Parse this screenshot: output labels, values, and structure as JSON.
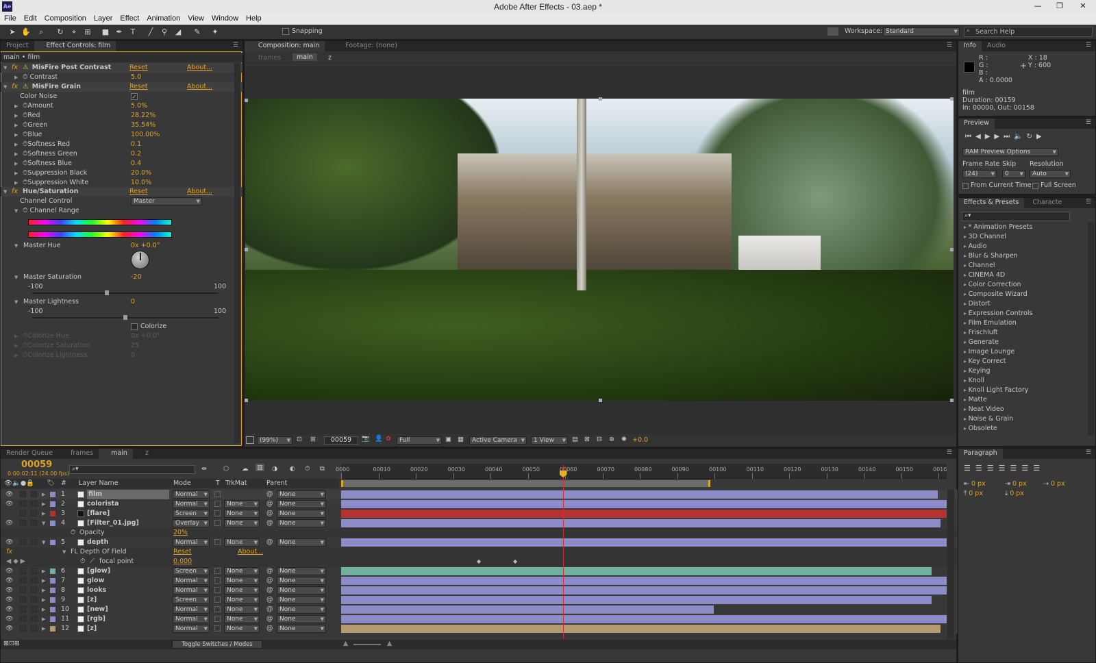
{
  "app": {
    "title": "Adobe After Effects - 03.aep *",
    "logo": "Ae"
  },
  "menu": [
    "File",
    "Edit",
    "Composition",
    "Layer",
    "Effect",
    "Animation",
    "View",
    "Window",
    "Help"
  ],
  "toolbar": {
    "snapping": "Snapping",
    "workspace_label": "Workspace:",
    "workspace_value": "Standard",
    "search_placeholder": "Search Help"
  },
  "left_panel": {
    "tabs": [
      "Project",
      "Effect Controls: film"
    ],
    "breadcrumb": "main • film",
    "effects": [
      {
        "name": "MisFire Post Contrast",
        "reset": "Reset",
        "about": "About..."
      },
      {
        "name": "MisFire Grain",
        "reset": "Reset",
        "about": "About..."
      },
      {
        "name": "Hue/Saturation",
        "reset": "Reset",
        "about": "About..."
      }
    ],
    "contrast": {
      "label": "Contrast",
      "value": "5.0"
    },
    "color_noise": {
      "label": "Color Noise",
      "value": "✓"
    },
    "grain_params": [
      {
        "label": "Amount",
        "value": "5.0%"
      },
      {
        "label": "Red",
        "value": "28.22%"
      },
      {
        "label": "Green",
        "value": "35.54%"
      },
      {
        "label": "Blue",
        "value": "100.00%"
      },
      {
        "label": "Softness Red",
        "value": "0.1"
      },
      {
        "label": "Softness Green",
        "value": "0.2"
      },
      {
        "label": "Softness Blue",
        "value": "0.4"
      },
      {
        "label": "Suppression Black",
        "value": "20.0%"
      },
      {
        "label": "Suppression White",
        "value": "10.0%"
      }
    ],
    "channel_control": {
      "label": "Channel Control",
      "value": "Master"
    },
    "channel_range": "Channel Range",
    "master_hue": {
      "label": "Master Hue",
      "value": "0x +0.0°"
    },
    "master_saturation": {
      "label": "Master Saturation",
      "value": "-20",
      "min": "-100",
      "max": "100",
      "level": 0.4
    },
    "master_lightness": {
      "label": "Master Lightness",
      "value": "0",
      "min": "-100",
      "max": "100",
      "level": 0.5
    },
    "colorize": "Colorize",
    "disabled": [
      {
        "label": "Colorize Hue",
        "value": "0x +0.0°"
      },
      {
        "label": "Colorize Saturation",
        "value": "25"
      },
      {
        "label": "Colorize Lightness",
        "value": "0"
      }
    ]
  },
  "comp_panel": {
    "tabs": [
      "Composition: main",
      "Footage: (none)"
    ],
    "subtabs": [
      "frames",
      "main",
      "z"
    ],
    "footer": {
      "zoom": "(99%)",
      "timecode": "00059",
      "resolution": "Full",
      "camera": "Active Camera",
      "views": "1 View",
      "exposure": "+0.0"
    }
  },
  "info_panel": {
    "tabs": [
      "Info",
      "Audio"
    ],
    "r": "R :",
    "g": "G :",
    "b": "B :",
    "a": "A : 0.0000",
    "x": "X : 18",
    "y": "Y : 600",
    "name": "film",
    "duration": "Duration: 00159",
    "inout": "In: 00000, Out: 00158"
  },
  "preview_panel": {
    "tab": "Preview",
    "ram_options": "RAM Preview Options",
    "frame_rate": {
      "label": "Frame Rate",
      "value": "(24)"
    },
    "skip": {
      "label": "Skip",
      "value": "0"
    },
    "resolution": {
      "label": "Resolution",
      "value": "Auto"
    },
    "from_current": "From Current Time",
    "full_screen": "Full Screen"
  },
  "effects_panel": {
    "tabs": [
      "Effects & Presets",
      "Characte"
    ],
    "items": [
      "* Animation Presets",
      "3D Channel",
      "Audio",
      "Blur & Sharpen",
      "Channel",
      "CINEMA 4D",
      "Color Correction",
      "Composite Wizard",
      "Distort",
      "Expression Controls",
      "Film Emulation",
      "Frischluft",
      "Generate",
      "Image Lounge",
      "Key Correct",
      "Keying",
      "Knoll",
      "Knoll Light Factory",
      "Matte",
      "Neat Video",
      "Noise & Grain",
      "Obsolete"
    ]
  },
  "paragraph_panel": {
    "tab": "Paragraph",
    "values": [
      "0 px",
      "0 px",
      "0 px",
      "0 px",
      "0 px"
    ]
  },
  "timeline": {
    "tabs": [
      "Render Queue",
      "frames",
      "main",
      "z"
    ],
    "current_time": "00059",
    "timecode_sub": "0:00:02:11 (24.00 fps)",
    "headers": {
      "num": "#",
      "name": "Layer Name",
      "mode": "Mode",
      "t": "T",
      "trkmat": "TrkMat",
      "parent": "Parent"
    },
    "ruler": [
      "0000",
      "00010",
      "00020",
      "00030",
      "00040",
      "00050",
      "00060",
      "00070",
      "00080",
      "00090",
      "00100",
      "00110",
      "00120",
      "00130",
      "00140",
      "00150",
      "0016"
    ],
    "layers": [
      {
        "num": "1",
        "name": "film",
        "mode": "Normal",
        "trkmat": "",
        "parent": "None",
        "color": "#8c8cc8",
        "end": 0.985
      },
      {
        "num": "2",
        "name": "colorista",
        "mode": "Normal",
        "trkmat": "None",
        "parent": "None",
        "color": "#8c8cc8",
        "end": 1.0
      },
      {
        "num": "3",
        "name": "[flare]",
        "mode": "Screen",
        "trkmat": "None",
        "parent": "None",
        "color": "#b43232",
        "end": 1.0
      },
      {
        "num": "4",
        "name": "[Filter_01.jpg]",
        "mode": "Overlay",
        "trkmat": "None",
        "parent": "None",
        "color": "#8c8cc8",
        "end": 0.99
      },
      {
        "num": "5",
        "name": "depth",
        "mode": "Normal",
        "trkmat": "None",
        "parent": "None",
        "color": "#8c8cc8",
        "end": 1.0
      },
      {
        "num": "6",
        "name": "[glow]",
        "mode": "Screen",
        "trkmat": "None",
        "parent": "None",
        "color": "#6fb0a0",
        "end": 0.975
      },
      {
        "num": "7",
        "name": "glow",
        "mode": "Normal",
        "trkmat": "None",
        "parent": "None",
        "color": "#8c8cc8",
        "end": 1.0
      },
      {
        "num": "8",
        "name": "looks",
        "mode": "Normal",
        "trkmat": "None",
        "parent": "None",
        "color": "#8c8cc8",
        "end": 1.0
      },
      {
        "num": "9",
        "name": "[z]",
        "mode": "Screen",
        "trkmat": "None",
        "parent": "None",
        "color": "#8c8cc8",
        "end": 0.975
      },
      {
        "num": "10",
        "name": "[new]",
        "mode": "Normal",
        "trkmat": "None",
        "parent": "None",
        "color": "#8c8cc8",
        "end": 0.615
      },
      {
        "num": "11",
        "name": "[rgb]",
        "mode": "Normal",
        "trkmat": "None",
        "parent": "None",
        "color": "#8c8cc8",
        "end": 1.0
      },
      {
        "num": "12",
        "name": "[z]",
        "mode": "Normal",
        "trkmat": "None",
        "parent": "None",
        "color": "#b49a70",
        "end": 0.99
      }
    ],
    "opacity": {
      "label": "Opacity",
      "value": "20%"
    },
    "fl_depth": {
      "label": "FL Depth Of Field",
      "reset": "Reset",
      "about": "About..."
    },
    "focal_point": {
      "label": "focal point",
      "value": "0.000"
    },
    "toggle": "Toggle Switches / Modes",
    "playhead": 0.366,
    "work_area_end": 0.61
  }
}
